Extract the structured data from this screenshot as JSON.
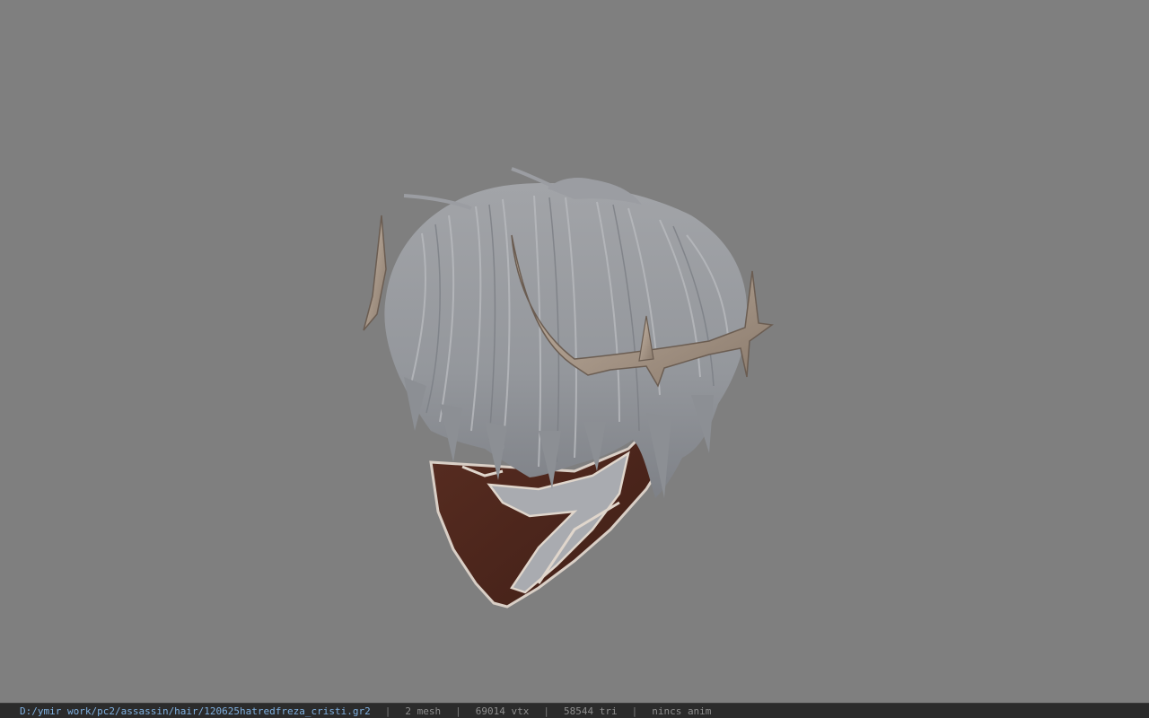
{
  "viewer": {
    "background_color": "#7f7f7f",
    "model_icon": "hair-mask-3d-model"
  },
  "status_bar": {
    "file_path": "D:/ymir work/pc2/assassin/hair/120625hatredfreza_cristi.gr2",
    "separator": "|",
    "mesh_count": "2 mesh",
    "vertex_count": "69014 vtx",
    "triangle_count": "58544 tri",
    "anim_status": "nincs anim",
    "path_color": "#7fb0e0",
    "bar_color": "#2b2b2b"
  }
}
